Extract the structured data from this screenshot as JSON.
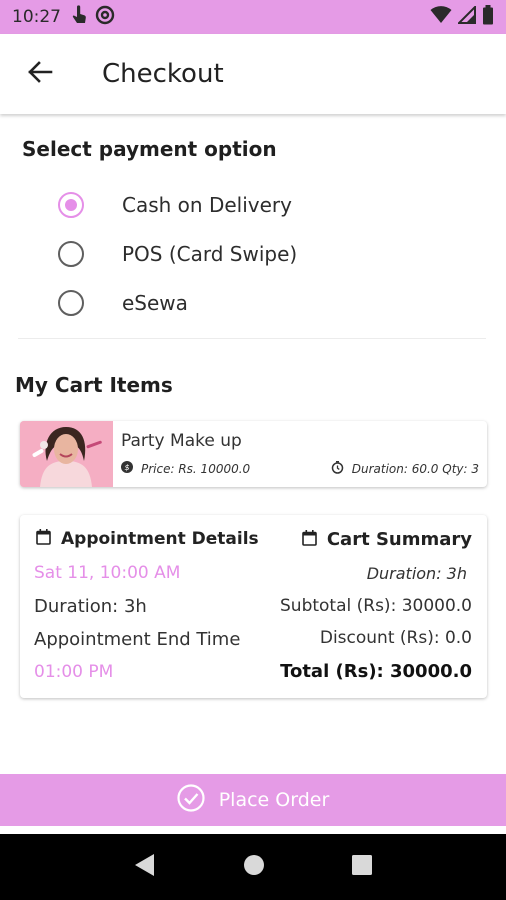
{
  "status_bar": {
    "time": "10:27",
    "left_icons": [
      "hand-touch-icon",
      "at-sign-icon"
    ],
    "right_icons": [
      "wifi-icon",
      "signal-icon",
      "battery-icon"
    ],
    "color": "#e59be6"
  },
  "app_bar": {
    "title": "Checkout",
    "back_icon": "arrow-left-icon"
  },
  "payment": {
    "section_title": "Select payment option",
    "options": [
      {
        "label": "Cash on Delivery",
        "selected": true
      },
      {
        "label": "POS (Card Swipe)",
        "selected": false
      },
      {
        "label": "eSewa",
        "selected": false
      }
    ],
    "accent": "#e58fe8"
  },
  "cart": {
    "section_title": "My Cart Items",
    "items": [
      {
        "name": "Party Make up",
        "price": "Price: Rs. 10000.0",
        "duration_qty": "Duration: 60.0  Qty: 3",
        "price_icon": "dollar-circle-icon",
        "duration_icon": "timer-icon"
      }
    ]
  },
  "appointment": {
    "title": "Appointment Details",
    "date_time": "Sat  11,  10:00 AM",
    "duration": "Duration: 3h",
    "end_time_label": "Appointment End Time",
    "end_time": "01:00 PM",
    "highlight_color": "#e58fe8"
  },
  "summary": {
    "title": "Cart Summary",
    "duration": "Duration: 3h",
    "subtotal": "Subtotal (Rs): 30000.0",
    "discount": "Discount (Rs): 0.0",
    "total": "Total (Rs): 30000.0"
  },
  "footer": {
    "place_order_label": "Place Order",
    "button_color": "#e59be6"
  },
  "nav_bar": {
    "icons": [
      "back-triangle-icon",
      "home-circle-icon",
      "recents-square-icon"
    ]
  }
}
